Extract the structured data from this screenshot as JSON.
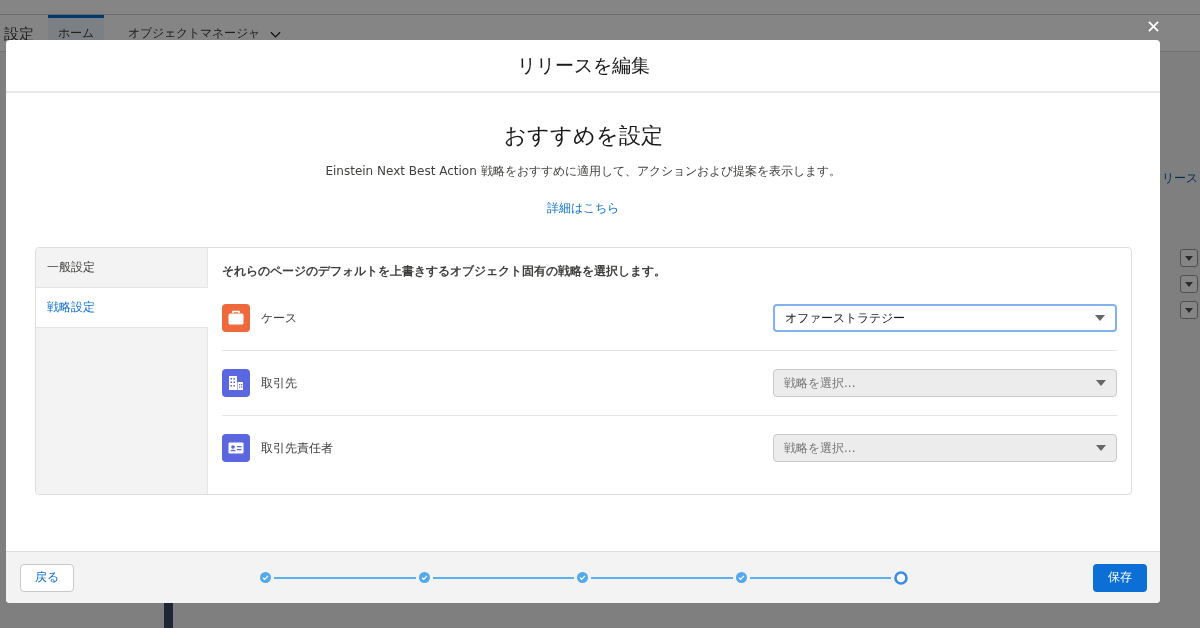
{
  "background": {
    "app_title": "設定",
    "tabs": [
      {
        "label": "ホーム",
        "selected": true
      },
      {
        "label": "オブジェクトマネージャ",
        "selected": false
      }
    ],
    "side_link": "リース"
  },
  "modal": {
    "title": "リリースを編集",
    "heading": "おすすめを設定",
    "description": "Einstein Next Best Action 戦略をおすすめに適用して、アクションおよび提案を表示します。",
    "link": "詳細はこちら",
    "nav": [
      {
        "label": "一般設定",
        "selected": false
      },
      {
        "label": "戦略設定",
        "selected": true
      }
    ],
    "instruction": "それらのページのデフォルトを上書きするオブジェクト固有の戦略を選択します。",
    "rows": [
      {
        "kind": "case",
        "label": "ケース",
        "color": "#ee6a3c",
        "select": {
          "value": "オファーストラテジー",
          "disabled": false
        }
      },
      {
        "kind": "account",
        "label": "取引先",
        "color": "#5a67e0",
        "select": {
          "placeholder": "戦略を選択...",
          "disabled": true
        }
      },
      {
        "kind": "contact",
        "label": "取引先責任者",
        "color": "#5a67e0",
        "select": {
          "placeholder": "戦略を選択...",
          "disabled": true
        }
      }
    ],
    "back_button": "戻る",
    "save_button": "保存",
    "steps": [
      {
        "complete": true
      },
      {
        "complete": true
      },
      {
        "complete": true
      },
      {
        "complete": true
      },
      {
        "complete": false
      }
    ]
  }
}
